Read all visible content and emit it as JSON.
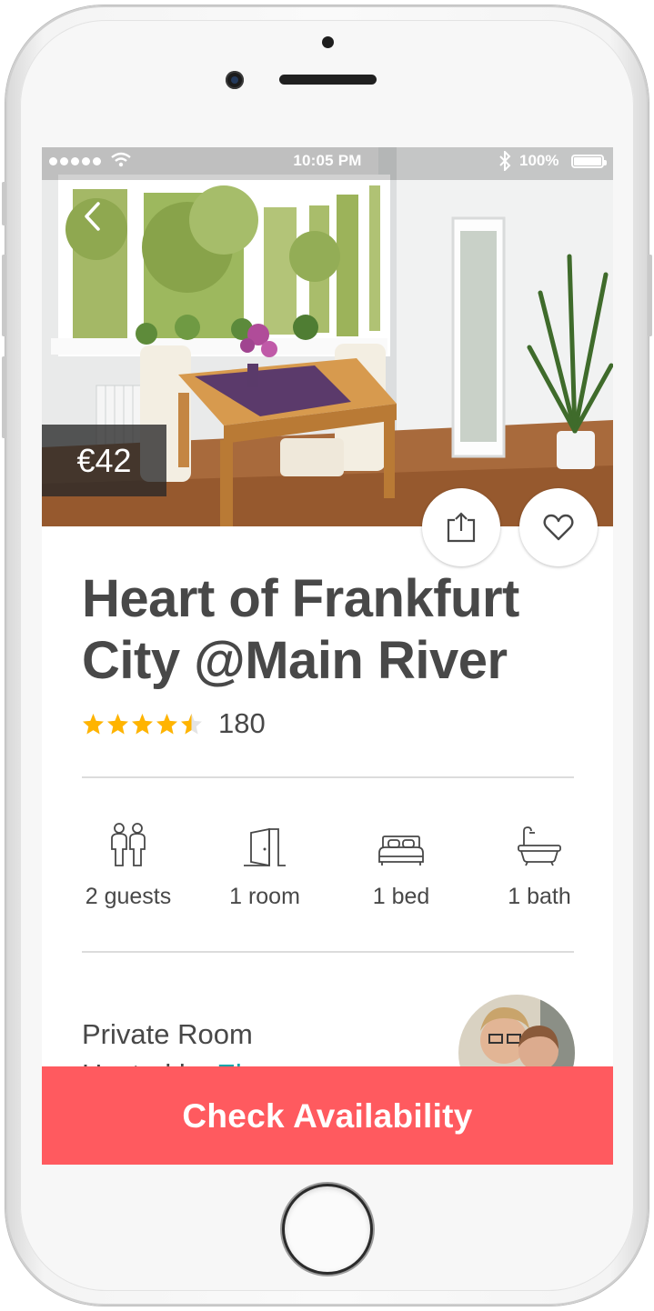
{
  "status_bar": {
    "time": "10:05 PM",
    "battery": "100%"
  },
  "listing": {
    "price": "€42",
    "title": "Heart of Frankfurt City @Main River",
    "rating": 4.5,
    "max_rating": 5,
    "reviews": "180",
    "room_type": "Private Room",
    "hosted_prefix": "Hosted by",
    "host_name": "El"
  },
  "amenities": [
    {
      "icon": "guests-icon",
      "label": "2 guests"
    },
    {
      "icon": "door-icon",
      "label": "1 room"
    },
    {
      "icon": "bed-icon",
      "label": "1 bed"
    },
    {
      "icon": "bathtub-icon",
      "label": "1 bath"
    }
  ],
  "actions": {
    "check_availability": "Check Availability"
  },
  "colors": {
    "accent": "#ff5a5f",
    "text": "#484848",
    "star": "#ffb400",
    "link": "#00a3a8"
  }
}
